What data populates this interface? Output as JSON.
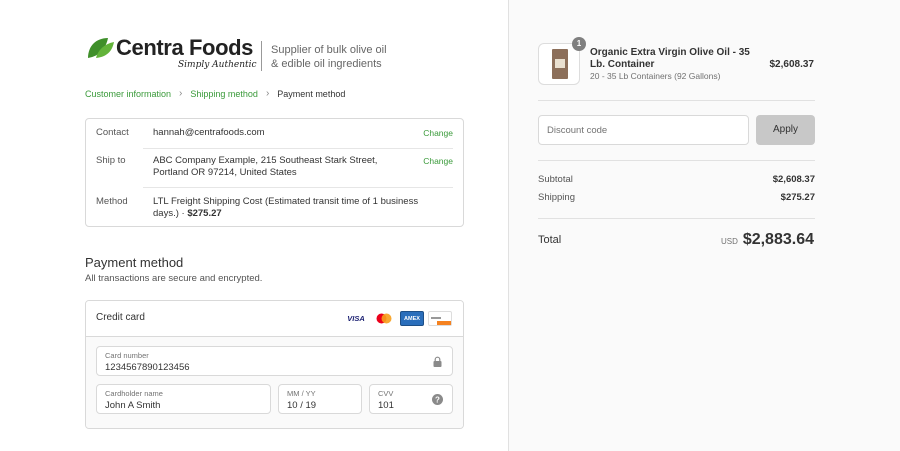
{
  "logo": {
    "name": "Centra Foods",
    "tagline": "Simply Authentic",
    "subtitle_line1": "Supplier of bulk olive oil",
    "subtitle_line2": "& edible oil ingredients"
  },
  "breadcrumbs": [
    {
      "label": "Customer information"
    },
    {
      "label": "Shipping method"
    },
    {
      "label": "Payment method"
    }
  ],
  "review": {
    "contact_label": "Contact",
    "contact_value": "hannah@centrafoods.com",
    "ship_label": "Ship to",
    "ship_value_line1": "ABC Company Example, 215 Southeast Stark Street,",
    "ship_value_line2": "Portland OR 97214, United States",
    "method_label": "Method",
    "method_value_line1": "LTL Freight Shipping Cost (Estimated transit time of 1 business",
    "method_value_line2_prefix": "days.) · ",
    "method_value_line2_price": "$275.27",
    "change_label": "Change"
  },
  "payment": {
    "title": "Payment method",
    "subtitle": "All transactions are secure and encrypted.",
    "credit_card_label": "Credit card",
    "brands": {
      "visa": "VISA",
      "amex": "AMEX"
    },
    "card_number_label": "Card number",
    "card_number_value": "1234567890123456",
    "cardholder_label": "Cardholder name",
    "cardholder_value": "John A Smith",
    "expiry_label": "MM / YY",
    "expiry_value": "10 / 19",
    "cvv_label": "CVV",
    "cvv_value": "101"
  },
  "order": {
    "quantity": "1",
    "product_line1": "Organic Extra Virgin Olive Oil - 35",
    "product_line2": "Lb. Container",
    "variant": "20 - 35 Lb Containers (92 Gallons)",
    "price": "$2,608.37",
    "discount_placeholder": "Discount code",
    "apply_label": "Apply",
    "subtotal_label": "Subtotal",
    "subtotal_value": "$2,608.37",
    "shipping_label": "Shipping",
    "shipping_value": "$275.27",
    "total_label": "Total",
    "currency": "USD",
    "total_value": "$2,883.64"
  },
  "colors": {
    "accent": "#3a9a3a",
    "button": "#c8c8c8",
    "panel": "#fafafa"
  }
}
